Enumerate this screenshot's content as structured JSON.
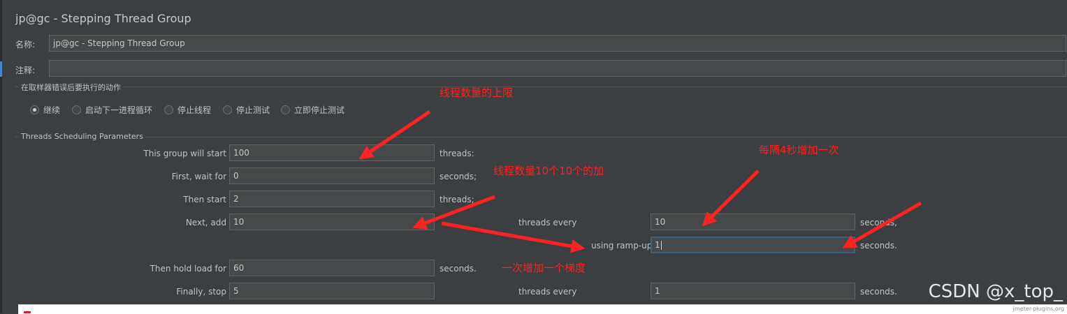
{
  "panel": {
    "title": "jp@gc - Stepping Thread Group"
  },
  "name_field": {
    "label": "名称:",
    "value": "jp@gc - Stepping Thread Group"
  },
  "comment_field": {
    "label": "注释:",
    "value": ""
  },
  "sampler_error_group": {
    "title": "在取样器错误后要执行的动作",
    "options": [
      {
        "label": "继续",
        "checked": true
      },
      {
        "label": "启动下一进程循环",
        "checked": false
      },
      {
        "label": "停止线程",
        "checked": false
      },
      {
        "label": "停止测试",
        "checked": false
      },
      {
        "label": "立即停止测试",
        "checked": false
      }
    ]
  },
  "scheduling": {
    "title": "Threads Scheduling Parameters",
    "this_group_will_start": {
      "label": "This group will start",
      "value": "100",
      "unit": "threads:"
    },
    "first_wait_for": {
      "label": "First, wait for",
      "value": "0",
      "unit": "seconds;"
    },
    "then_start": {
      "label": "Then start",
      "value": "2",
      "unit": "threads;"
    },
    "next_add": {
      "label": "Next, add",
      "value": "10",
      "every_label": "threads every",
      "every_value": "10",
      "every_unit": "seconds,"
    },
    "ramp_up": {
      "label": "using ramp-up",
      "value": "1",
      "unit": "seconds."
    },
    "hold_load": {
      "label": "Then hold load for",
      "value": "60",
      "unit": "seconds."
    },
    "finally_stop": {
      "label": "Finally, stop",
      "value": "5",
      "every_label": "threads every",
      "every_value": "1",
      "every_unit": "seconds."
    }
  },
  "annotations": {
    "thread_limit": "线程数量的上限",
    "every_4s": "每隔4秒增加一次",
    "add_by_10": "线程数量10个10个的加",
    "one_step": "一次增加一个梯度",
    "color": "#ff2222"
  },
  "watermark": "CSDN @x_top_",
  "footer_note": "jmeter-plugins.org"
}
